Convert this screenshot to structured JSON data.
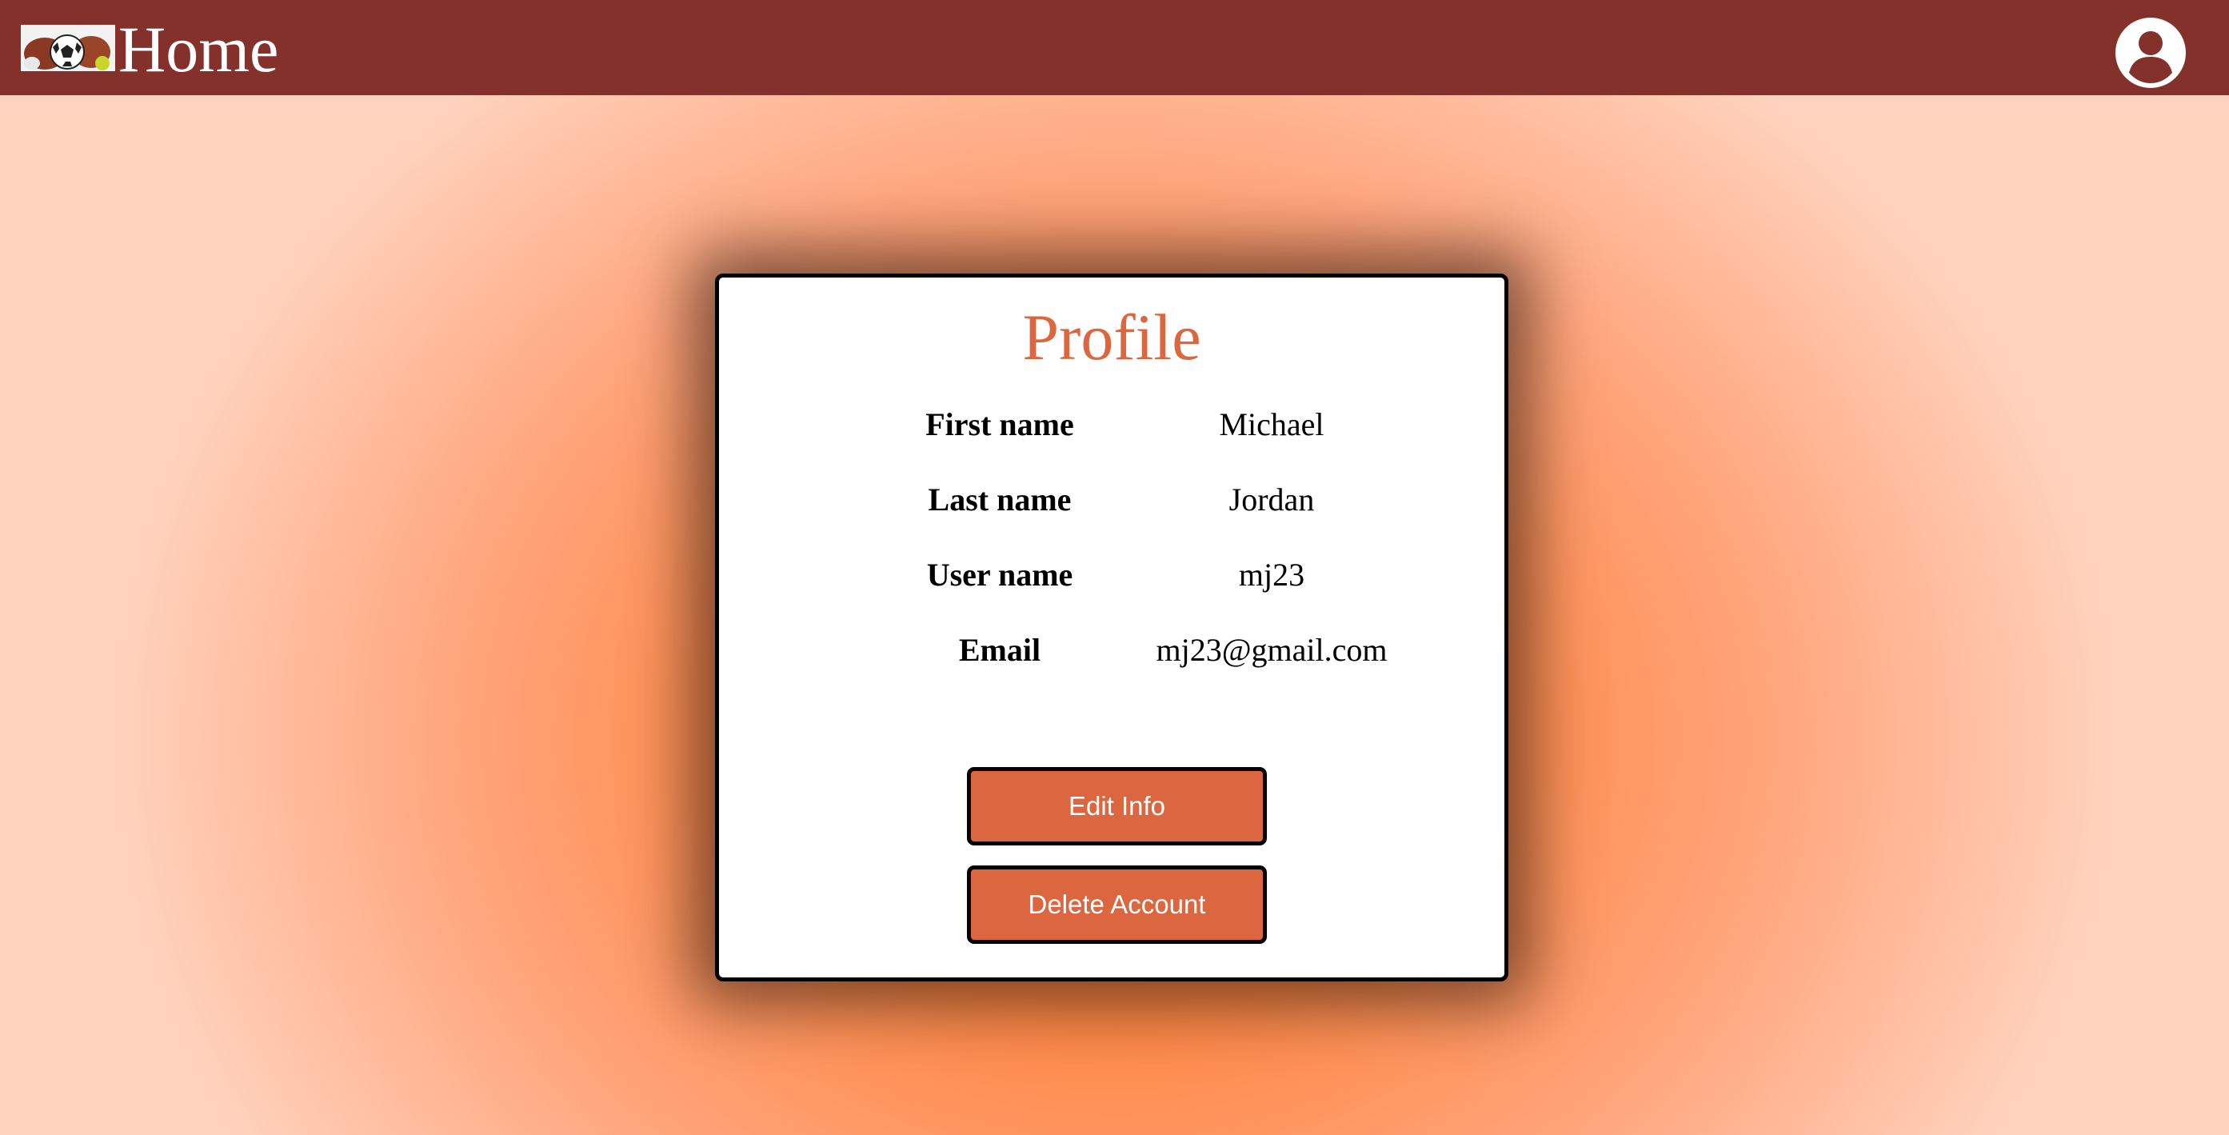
{
  "header": {
    "home_label": "Home",
    "logo_icon": "soccer-ball-dog-logo",
    "account_icon": "user-circle-icon",
    "bg_color": "#85312b"
  },
  "profile": {
    "title": "Profile",
    "title_color": "#dc6640",
    "fields": [
      {
        "label": "First name",
        "value": "Michael"
      },
      {
        "label": "Last name",
        "value": "Jordan"
      },
      {
        "label": "User name",
        "value": "mj23"
      },
      {
        "label": "Email",
        "value": "mj23@gmail.com"
      }
    ]
  },
  "actions": {
    "edit_label": "Edit Info",
    "delete_label": "Delete Account",
    "button_color": "#dc6640"
  }
}
